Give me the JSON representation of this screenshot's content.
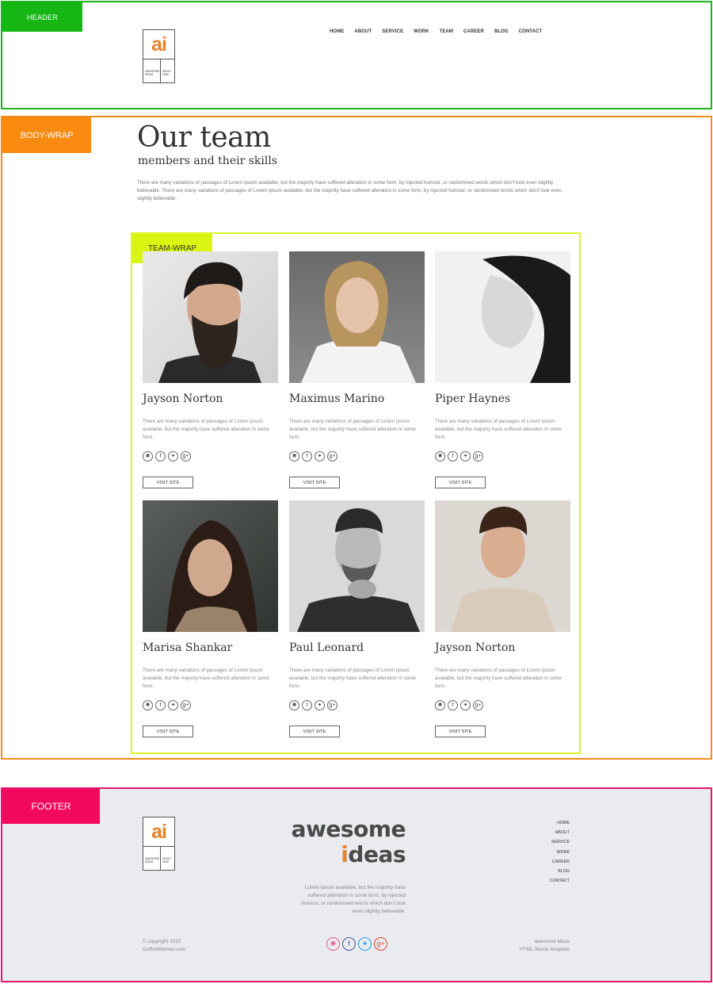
{
  "labels": {
    "header": "HEADER",
    "body_wrap": "BODY-WRAP",
    "team_wrap": "TEAM-WRAP",
    "footer": "FOOTER"
  },
  "logo": {
    "mark": "ai",
    "left_text": "AWESOME IDEAS",
    "right_text": "SINCE 2000"
  },
  "nav": [
    "HOME",
    "ABOUT",
    "SERVICE",
    "WORK",
    "TEAM",
    "CAREER",
    "BLOG",
    "CONTACT"
  ],
  "page": {
    "title": "Our team",
    "subtitle": "members and their skills",
    "intro": "There are many variations of passages of Lorem Ipsum available, but the majority have suffered alteration in some form, by injected humour, or randomised words which don't look even slightly believable. There are many variations of passages of Lorem Ipsum available, but the majority have suffered alteration in some form, by injected humour, or randomised words which don't look even slightly believable."
  },
  "team": [
    {
      "name": "Jayson Norton",
      "desc": "There are many variations of passages of Lorem Ipsum available, but the majority have suffered alteration in some form.",
      "button": "VISIT SITE"
    },
    {
      "name": "Maximus Marino",
      "desc": "There are many variations of passages of Lorem Ipsum available, but the majority have suffered alteration in some form.",
      "button": "VISIT SITE"
    },
    {
      "name": "Piper Haynes",
      "desc": "There are many variations of passages of Lorem Ipsum available, but the majority have suffered alteration in some form.",
      "button": "VISIT SITE"
    },
    {
      "name": "Marisa Shankar",
      "desc": "There are many variations of passages of Lorem Ipsum available, but the majority have suffered alteration in some form.",
      "button": "VISIT SITE"
    },
    {
      "name": "Paul Leonard",
      "desc": "There are many variations of passages of Lorem Ipsum available, but the majority have suffered alteration in some form.",
      "button": "VISIT SITE"
    },
    {
      "name": "Jayson Norton",
      "desc": "There are many variations of passages of Lorem Ipsum available, but the majority have suffered alteration in some form.",
      "button": "VISIT SITE"
    }
  ],
  "social_icons": [
    "dribbble-icon",
    "facebook-icon",
    "twitter-icon",
    "google-plus-icon"
  ],
  "footer": {
    "brand_line1": "awesome",
    "brand_line2_accent": "i",
    "brand_line2_rest": "deas",
    "about": "Lorem Ipsum available, but the majority have suffered alteration in some form, by injected humour, or randomised words which don't look even slightly believable.",
    "nav": [
      "HOME",
      "ABOUT",
      "SERVICE",
      "WORK",
      "CAREER",
      "BLOG",
      "CONTACT"
    ],
    "copyright_line1": "© copyright 2015",
    "copyright_line2": "Geffortthemes.com",
    "tagline_line1": "awesome ideas",
    "tagline_line2": "HTML theme template"
  },
  "colors": {
    "header_tag": "#16b715",
    "body_tag": "#fb8a10",
    "team_tag": "#daf512",
    "footer_tag": "#f2095b",
    "logo_accent": "#e8822a",
    "footer_bg": "#e9ebee",
    "footer_social": [
      "#e35e8c",
      "#3b5998",
      "#1da1f2",
      "#dd4b39"
    ]
  }
}
